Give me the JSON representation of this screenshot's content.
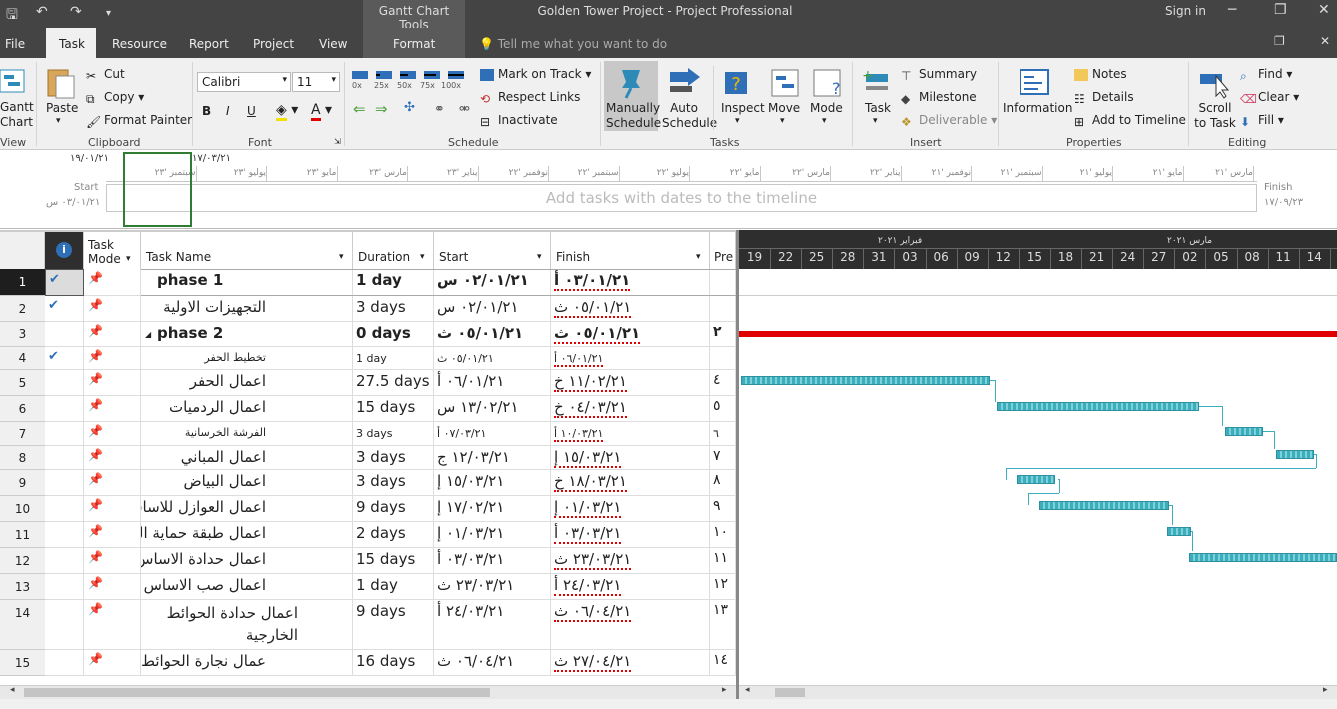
{
  "title_bar": {
    "app_title": "Golden Tower Project - Project Professional",
    "contextual_title": "Gantt Chart Tools",
    "signin": "Sign in"
  },
  "tabs": [
    "File",
    "Task",
    "Resource",
    "Report",
    "Project",
    "View",
    "Format"
  ],
  "tell_me": "Tell me what you want to do",
  "ribbon": {
    "view": {
      "button": "Gantt Chart",
      "label": "View"
    },
    "clipboard": {
      "paste": "Paste",
      "cut": "Cut",
      "copy": "Copy",
      "format_painter": "Format Painter",
      "label": "Clipboard"
    },
    "font": {
      "name": "Calibri",
      "size": "11",
      "label": "Font",
      "bold": "B",
      "italic": "I",
      "underline": "U"
    },
    "schedule": {
      "pcts": [
        "0x",
        "25x",
        "50x",
        "75x",
        "100x"
      ],
      "mark_on_track": "Mark on Track",
      "respect_links": "Respect Links",
      "inactivate": "Inactivate",
      "label": "Schedule"
    },
    "tasks": {
      "manually": "Manually Schedule",
      "auto": "Auto Schedule",
      "inspect": "Inspect",
      "move": "Move",
      "mode": "Mode",
      "label": "Tasks"
    },
    "insert": {
      "task": "Task",
      "summary": "Summary",
      "milestone": "Milestone",
      "deliverable": "Deliverable",
      "label": "Insert"
    },
    "properties": {
      "information": "Information",
      "notes": "Notes",
      "details": "Details",
      "add_to_timeline": "Add to Timeline",
      "label": "Properties"
    },
    "editing": {
      "scroll_to_task": "Scroll to Task",
      "find": "Find",
      "clear": "Clear",
      "fill": "Fill",
      "label": "Editing"
    }
  },
  "timeline": {
    "start_label": "Start",
    "start_date": "٠٣/٠١/٢١ س",
    "finish_label": "Finish",
    "finish_date": "١٧/٠٩/٢٣",
    "add_text": "Add tasks with dates to the timeline",
    "left_date_1": "١٩/٠١/٢١",
    "left_date_2": "١٧/٠٣/٢١",
    "months": [
      "مارس '٢١",
      "مايو '٢١",
      "يوليو '٢١",
      "سبتمبر '٢١",
      "نوفمبر '٢١",
      "يناير '٢٢",
      "مارس '٢٢",
      "مايو '٢٢",
      "يوليو '٢٢",
      "سبتمبر '٢٢",
      "نوفمبر '٢٢",
      "يناير '٢٣",
      "مارس '٢٣",
      "مايو '٢٣",
      "يوليو '٢٣",
      "سبتمبر '٢٣"
    ]
  },
  "grid_headers": {
    "task_mode": "Task Mode",
    "task_name": "Task Name",
    "duration": "Duration",
    "start": "Start",
    "finish": "Finish",
    "pred": "Pre"
  },
  "tasks": [
    {
      "id": "1",
      "check": true,
      "name": "phase 1",
      "bold": true,
      "duration": "1 day",
      "start": "٠٢/٠١/٢١ س",
      "finish": "٠٣/٠١/٢١ أ",
      "pred": ""
    },
    {
      "id": "2",
      "check": true,
      "name": "التجهيزات الاولية",
      "bold": false,
      "duration": "3 days",
      "start": "٠٢/٠١/٢١ س",
      "finish": "٠٥/٠١/٢١ ث",
      "pred": ""
    },
    {
      "id": "3",
      "check": false,
      "name": "phase 2",
      "bold": true,
      "duration": "0 days",
      "start": "٠٥/٠١/٢١ ث",
      "finish": "٠٥/٠١/٢١ ث",
      "pred": "٢"
    },
    {
      "id": "4",
      "check": true,
      "name": "تخطيط الحفر",
      "bold": false,
      "duration": "1 day",
      "start": "٠٥/٠١/٢١ ث",
      "finish": "٠٦/٠١/٢١ أ",
      "pred": ""
    },
    {
      "id": "5",
      "check": false,
      "name": "اعمال الحفر",
      "bold": false,
      "duration": "27.5 days",
      "start": "٠٦/٠١/٢١ أ",
      "finish": "١١/٠٢/٢١ خ",
      "pred": "٤"
    },
    {
      "id": "6",
      "check": false,
      "name": "اعمال الردميات",
      "bold": false,
      "duration": "15 days",
      "start": "١٣/٠٢/٢١ س",
      "finish": "٠٤/٠٣/٢١ خ",
      "pred": "٥"
    },
    {
      "id": "7",
      "check": false,
      "name": "الفرشة الخرسانية",
      "bold": false,
      "duration": "3 days",
      "start": "٠٧/٠٣/٢١ أ",
      "finish": "١٠/٠٣/٢١ أ",
      "pred": "٦"
    },
    {
      "id": "8",
      "check": false,
      "name": "اعمال المباني",
      "bold": false,
      "duration": "3 days",
      "start": "١٢/٠٣/٢١ ج",
      "finish": "١٥/٠٣/٢١ إ",
      "pred": "٧"
    },
    {
      "id": "9",
      "check": false,
      "name": "اعمال البياض",
      "bold": false,
      "duration": "3 days",
      "start": "١٥/٠٣/٢١ إ",
      "finish": "١٨/٠٣/٢١ خ",
      "pred": "٨"
    },
    {
      "id": "10",
      "check": false,
      "name": "اعمال العوازل للاساس",
      "bold": false,
      "duration": "9 days",
      "start": "١٧/٠٢/٢١ إ",
      "finish": "٠١/٠٣/٢١ إ",
      "pred": "٩"
    },
    {
      "id": "11",
      "check": false,
      "name": "اعمال طبقة حماية العازل",
      "bold": false,
      "duration": "2 days",
      "start": "٠١/٠٣/٢١ إ",
      "finish": "٠٣/٠٣/٢١ أ",
      "pred": "١٠"
    },
    {
      "id": "12",
      "check": false,
      "name": "اعمال حدادة الاساس",
      "bold": false,
      "duration": "15 days",
      "start": "٠٣/٠٣/٢١ أ",
      "finish": "٢٣/٠٣/٢١ ث",
      "pred": "١١"
    },
    {
      "id": "13",
      "check": false,
      "name": "اعمال صب الاساس",
      "bold": false,
      "duration": "1 day",
      "start": "٢٣/٠٣/٢١ ث",
      "finish": "٢٤/٠٣/٢١ أ",
      "pred": "١٢"
    },
    {
      "id": "14",
      "check": false,
      "name": "اعمال حدادة الحوائط الخارجية والداخليةوالاعمدة",
      "bold": false,
      "duration": "9 days",
      "start": "٢٤/٠٣/٢١ أ",
      "finish": "٠٦/٠٤/٢١ ث",
      "pred": "١٣"
    },
    {
      "id": "15",
      "check": false,
      "name": "عمال نجارة الحوائط الخارجية",
      "bold": false,
      "duration": "16 days",
      "start": "٠٦/٠٤/٢١ ث",
      "finish": "٢٧/٠٤/٢١ ث",
      "pred": "١٤"
    }
  ],
  "gantt": {
    "months": [
      {
        "label": "فبراير ٢٠٢١"
      },
      {
        "label": "مارس ٢٠٢١"
      }
    ],
    "days": [
      "19",
      "22",
      "25",
      "28",
      "31",
      "03",
      "06",
      "09",
      "12",
      "15",
      "18",
      "21",
      "24",
      "27",
      "02",
      "05",
      "08",
      "11",
      "14"
    ]
  },
  "colors": {
    "accent": "#2e8bb8",
    "critical": "#e00000",
    "bar": "#3aaebd"
  }
}
